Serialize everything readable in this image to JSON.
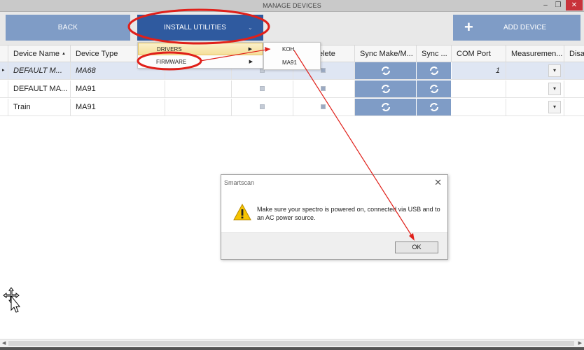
{
  "window": {
    "title": "MANAGE DEVICES",
    "minimize_glyph": "–",
    "restore_glyph": "❐",
    "close_glyph": "✕"
  },
  "toolbar": {
    "back_label": "BACK",
    "install_label": "INSTALL UTILITIES",
    "install_chevron": "⌄",
    "add_label": "ADD DEVICE",
    "add_icon": "+"
  },
  "menu": {
    "drivers_label": "DRIVERS",
    "firmware_label": "FIRMWARE",
    "submenu_arrow": "▶",
    "submenu": [
      "KOH",
      "MA91"
    ]
  },
  "grid": {
    "columns": [
      "Device Name",
      "Device Type",
      "",
      "",
      "elete",
      "Sync Make/M...",
      "Sync ...",
      "COM Port",
      "Measuremen...",
      "Disa"
    ],
    "sort_indicator": "▲",
    "rows": [
      {
        "name": "DEFAULT M...",
        "type": "MA68",
        "com_port": "1",
        "italic": true,
        "selected": true
      },
      {
        "name": "DEFAULT MA...",
        "type": "MA91",
        "com_port": "",
        "italic": false,
        "selected": false
      },
      {
        "name": "Train",
        "type": "MA91",
        "com_port": "",
        "italic": false,
        "selected": false
      }
    ],
    "combo_arrow": "▾",
    "row_indicator": "▸"
  },
  "dialog": {
    "title": "Smartscan",
    "message": "Make sure your spectro is powered on, connected via USB and to an AC power source.",
    "ok_label": "OK",
    "close_glyph": "✕"
  },
  "colors": {
    "accent_dark": "#2f5a9f",
    "accent_light": "#7f9cc6",
    "annotation_red": "#e0201a",
    "menu_highlight": "#f5df9a"
  },
  "icons": {
    "refresh": "refresh-icon",
    "warning": "warning-icon",
    "cursor": "move-cursor-icon"
  }
}
